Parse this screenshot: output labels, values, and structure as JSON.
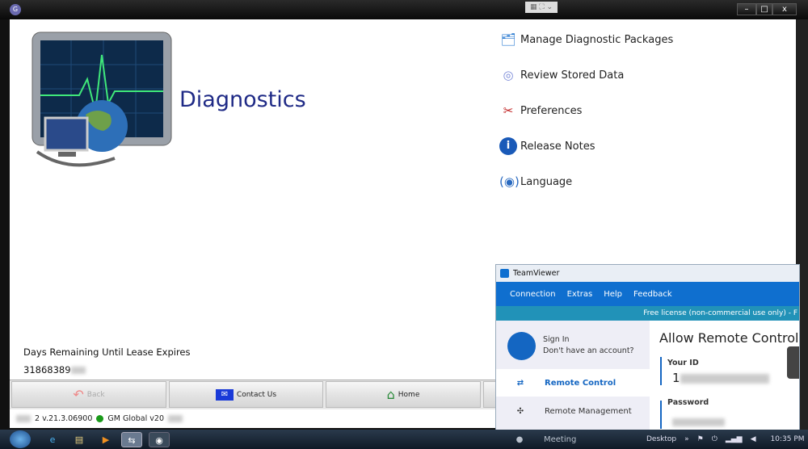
{
  "window": {
    "app_icon": "gds-icon",
    "minimize": "–",
    "maximize": "□",
    "close": "x"
  },
  "app": {
    "title": "Diagnostics",
    "menu": [
      {
        "label": "Manage Diagnostic Packages",
        "icon": "folder-package-icon"
      },
      {
        "label": "Review Stored Data",
        "icon": "disc-icon"
      },
      {
        "label": "Preferences",
        "icon": "tools-icon"
      },
      {
        "label": "Release Notes",
        "icon": "info-icon"
      },
      {
        "label": "Language",
        "icon": "language-icon"
      }
    ],
    "lease_label": "Days Remaining Until Lease Expires",
    "lease_value": "31868389",
    "buttons": {
      "back": "Back",
      "contact": "Contact Us",
      "home": "Home"
    },
    "status": {
      "version": "2 v.21.3.06900",
      "db": "GM Global v20"
    }
  },
  "teamviewer": {
    "title": "TeamViewer",
    "menu": [
      "Connection",
      "Extras",
      "Help",
      "Feedback"
    ],
    "license": "Free license (non-commercial use only) - F",
    "sign_in": "Sign In",
    "no_account": "Don't have an account?",
    "nav": [
      "Remote Control",
      "Remote Management",
      "Meeting"
    ],
    "heading": "Allow Remote Control",
    "your_id_label": "Your ID",
    "your_id": "1",
    "password_label": "Password"
  },
  "taskbar": {
    "desktop": "Desktop",
    "chevron": "»",
    "time": "10:35 PM"
  }
}
